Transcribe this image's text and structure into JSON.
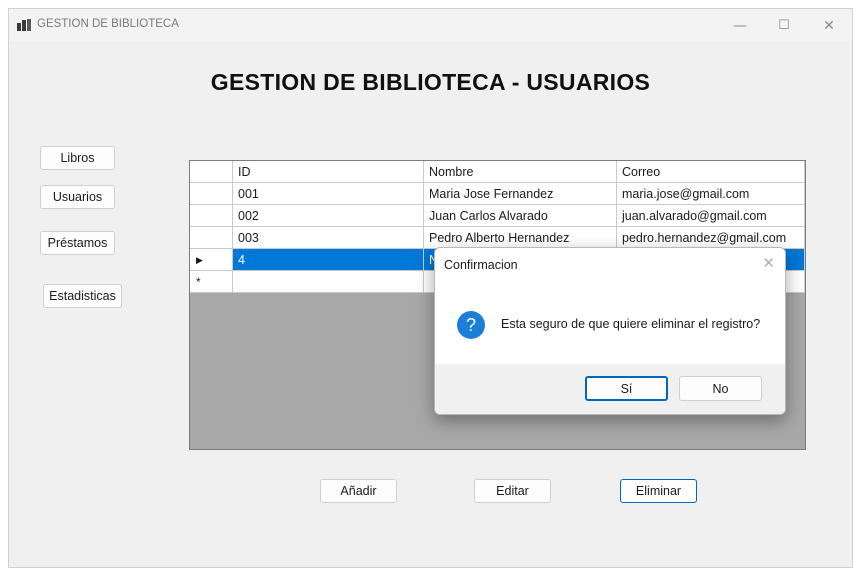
{
  "window": {
    "title": "GESTION DE BIBLIOTECA",
    "controls": {
      "minimize": "—",
      "maximize": "☐",
      "close": "✕"
    }
  },
  "page_title": "GESTION DE BIBLIOTECA - USUARIOS",
  "nav": {
    "libros": "Libros",
    "usuarios": "Usuarios",
    "prestamos": "Préstamos",
    "estadisticas": "Estadisticas"
  },
  "table": {
    "headers": {
      "id": "ID",
      "nombre": "Nombre",
      "correo": "Correo"
    },
    "rows": [
      {
        "id": "001",
        "nombre": "Maria Jose Fernandez",
        "correo": "maria.jose@gmail.com"
      },
      {
        "id": "002",
        "nombre": "Juan Carlos Alvarado",
        "correo": "juan.alvarado@gmail.com"
      },
      {
        "id": "003",
        "nombre": "Pedro Alberto Hernandez",
        "correo": "pedro.hernandez@gmail.com"
      },
      {
        "id": "4",
        "nombre": "N",
        "correo": ""
      }
    ],
    "selected_marker": "▶",
    "new_row_marker": "*",
    "selection_color": "#0078d7"
  },
  "actions": {
    "anadir": "Añadir",
    "editar": "Editar",
    "eliminar": "Eliminar"
  },
  "dialog": {
    "title": "Confirmacion",
    "close": "✕",
    "icon": "question-icon",
    "icon_glyph": "?",
    "message": "Esta seguro de que quiere eliminar el registro?",
    "yes": "Sí",
    "no": "No"
  }
}
